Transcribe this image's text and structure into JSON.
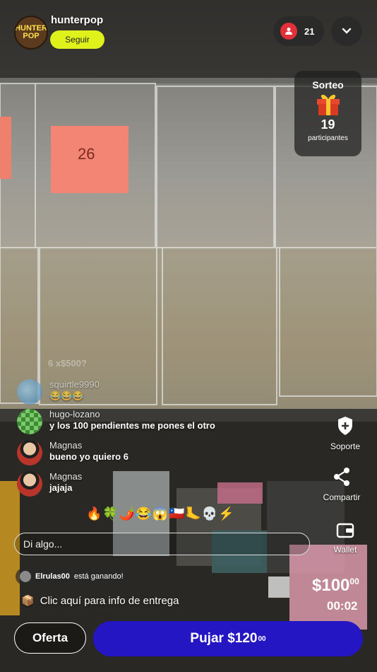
{
  "header": {
    "avatar_text": "HUNTER POP",
    "username": "hunterpop",
    "follow_label": "Seguir",
    "viewer_count": "21"
  },
  "sorteo": {
    "title": "Sorteo",
    "count": "19",
    "label": "participantes"
  },
  "stream": {
    "sticker_note": "26"
  },
  "chat": {
    "faded": "6 x$500?",
    "messages": [
      {
        "user": "squirtle9990",
        "text": "😂😂😂"
      },
      {
        "user": "hugo-lozano",
        "text": "y los 100 pendientes me pones el otro"
      },
      {
        "user": "Magnas",
        "text": "bueno yo quiero 6"
      },
      {
        "user": "Magnas",
        "text": "jajaja"
      }
    ]
  },
  "side": {
    "support": "Soporte",
    "share": "Compartir",
    "wallet": "Wallet"
  },
  "reactions": "🔥🍀🌶️😂😱🇨🇱🦶💀⚡",
  "input": {
    "placeholder": "Di algo..."
  },
  "winning": {
    "user": "Elrulas00",
    "text": "está ganando!"
  },
  "delivery": {
    "icon": "📦",
    "text": "Clic aquí para info de entrega"
  },
  "auction": {
    "price_main": "$100",
    "price_cents": "00",
    "timer": "00:02"
  },
  "buttons": {
    "offer": "Oferta",
    "bid_main": "Pujar $120",
    "bid_cents": "00"
  },
  "colors": {
    "follow": "#dff21b",
    "bid": "#2516c4",
    "viewer_badge": "#e0303a"
  }
}
